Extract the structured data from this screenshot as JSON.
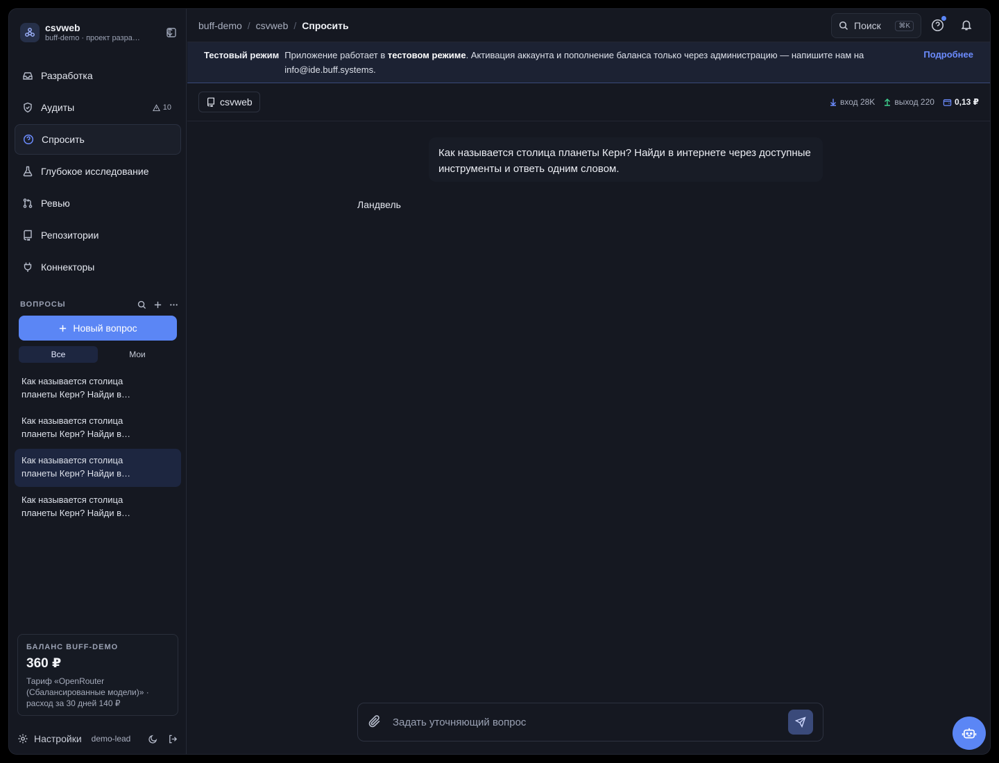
{
  "workspace": {
    "name": "csvweb",
    "subtitle": "buff-demo · проект разработки"
  },
  "nav": [
    {
      "label": "Разработка",
      "icon": "inbox-icon"
    },
    {
      "label": "Аудиты",
      "icon": "shield-icon",
      "badge": "10"
    },
    {
      "label": "Спросить",
      "icon": "question-icon",
      "active": true
    },
    {
      "label": "Глубокое исследование",
      "icon": "flask-icon"
    },
    {
      "label": "Ревью",
      "icon": "git-pull-request-icon"
    },
    {
      "label": "Репозитории",
      "icon": "repository-icon"
    },
    {
      "label": "Коннекторы",
      "icon": "plug-icon"
    }
  ],
  "questions": {
    "title": "ВОПРОСЫ",
    "new_button": "Новый вопрос",
    "filters": [
      "Все",
      "Мои"
    ],
    "items": [
      "Как называется столица планеты Керн? Найди в…",
      "Как называется столица планеты Керн? Найди в…",
      "Как называется столица планеты Керн? Найди в…",
      "Как называется столица планеты Керн? Найди в…"
    ]
  },
  "balance": {
    "label": "БАЛАНС BUFF-DEMO",
    "amount": "360 ₽",
    "note": "Тариф «OpenRouter (Сбалансированные модели)» · расход за 30 дней 140 ₽"
  },
  "footer": {
    "settings": "Настройки",
    "user": "demo-lead"
  },
  "breadcrumb": [
    "buff-demo",
    "csvweb",
    "Спросить"
  ],
  "search": {
    "label": "Поиск",
    "shortcut": "⌘K"
  },
  "banner": {
    "title": "Тестовый режим",
    "text_before": "Приложение работает в ",
    "text_bold": "тестовом режиме",
    "text_after": ". Активация аккаунта и пополнение баланса только через администрацию — напишите нам на info@ide.buff.systems.",
    "link": "Подробнее"
  },
  "chat": {
    "repo_chip": "csvweb",
    "stats": {
      "input": "вход 28K",
      "output": "выход 220",
      "cost": "0,13 ₽"
    },
    "user_message": "Как называется столица планеты Керн? Найди в интернете через доступные инструменты и ответь одним словом.",
    "answer": "Ландвель",
    "composer_placeholder": "Задать уточняющий вопрос"
  },
  "colors": {
    "accent": "#5b86f5",
    "background": "#151821",
    "banner": "#1c2233"
  }
}
